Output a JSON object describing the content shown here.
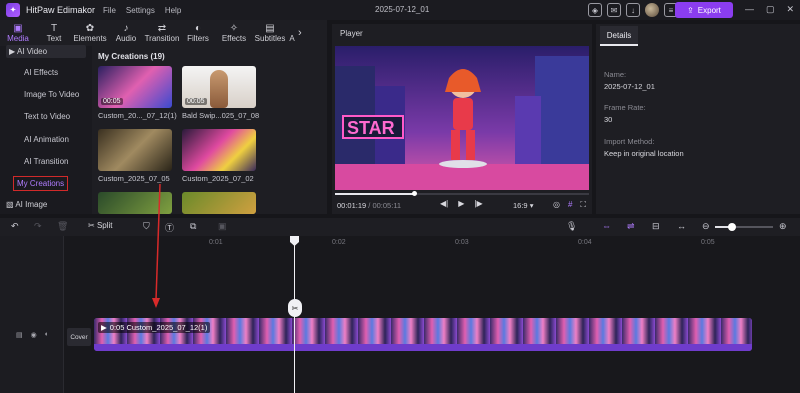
{
  "app": {
    "name": "HitPaw Edimakor",
    "menu": [
      "File",
      "Settings",
      "Help"
    ],
    "project_title": "2025-07-12_01",
    "export_label": "Export",
    "accent": "#8b3df0"
  },
  "toolbar_tabs": [
    {
      "label": "Media",
      "icon": "media-icon"
    },
    {
      "label": "Text",
      "icon": "text-icon"
    },
    {
      "label": "Elements",
      "icon": "elements-icon"
    },
    {
      "label": "Audio",
      "icon": "audio-icon"
    },
    {
      "label": "Transition",
      "icon": "transition-icon"
    },
    {
      "label": "Filters",
      "icon": "filters-icon"
    },
    {
      "label": "Effects",
      "icon": "effects-icon"
    },
    {
      "label": "Subtitles",
      "icon": "subtitles-icon"
    },
    {
      "label": "A",
      "icon": "more-icon"
    }
  ],
  "sidebar": {
    "section_top": "AI Video",
    "items": [
      "AI Effects",
      "Image To Video",
      "Text to Video",
      "AI Animation",
      "AI Transition",
      "My Creations"
    ],
    "section_bottom": "AI Image",
    "selected": "My Creations"
  },
  "media": {
    "title": "My Creations (19)",
    "items": [
      {
        "name": "Custom_20..._07_12(1)",
        "duration": "00:05"
      },
      {
        "name": "Bald Swip...025_07_08",
        "duration": "00:05"
      },
      {
        "name": "Custom_2025_07_05",
        "duration": ""
      },
      {
        "name": "Custom_2025_07_02",
        "duration": ""
      }
    ]
  },
  "player": {
    "title": "Player",
    "current_time": "00:01:19",
    "total_time": "/ 00:05:11",
    "ratio": "16:9",
    "progress": 0.31,
    "sign_text": "STAR"
  },
  "details": {
    "tab": "Details",
    "fields": [
      {
        "label": "Name:",
        "value": "2025-07-12_01"
      },
      {
        "label": "Frame Rate:",
        "value": "30"
      },
      {
        "label": "Import Method:",
        "value": "Keep in original location"
      }
    ]
  },
  "timeline": {
    "split_label": "Split",
    "ruler": [
      "0:01",
      "0:02",
      "0:03",
      "0:04",
      "0:05"
    ],
    "cover_label": "Cover",
    "clip_label": "0:05 Custom_2025_07_12(1)",
    "zoom": 0.3
  }
}
